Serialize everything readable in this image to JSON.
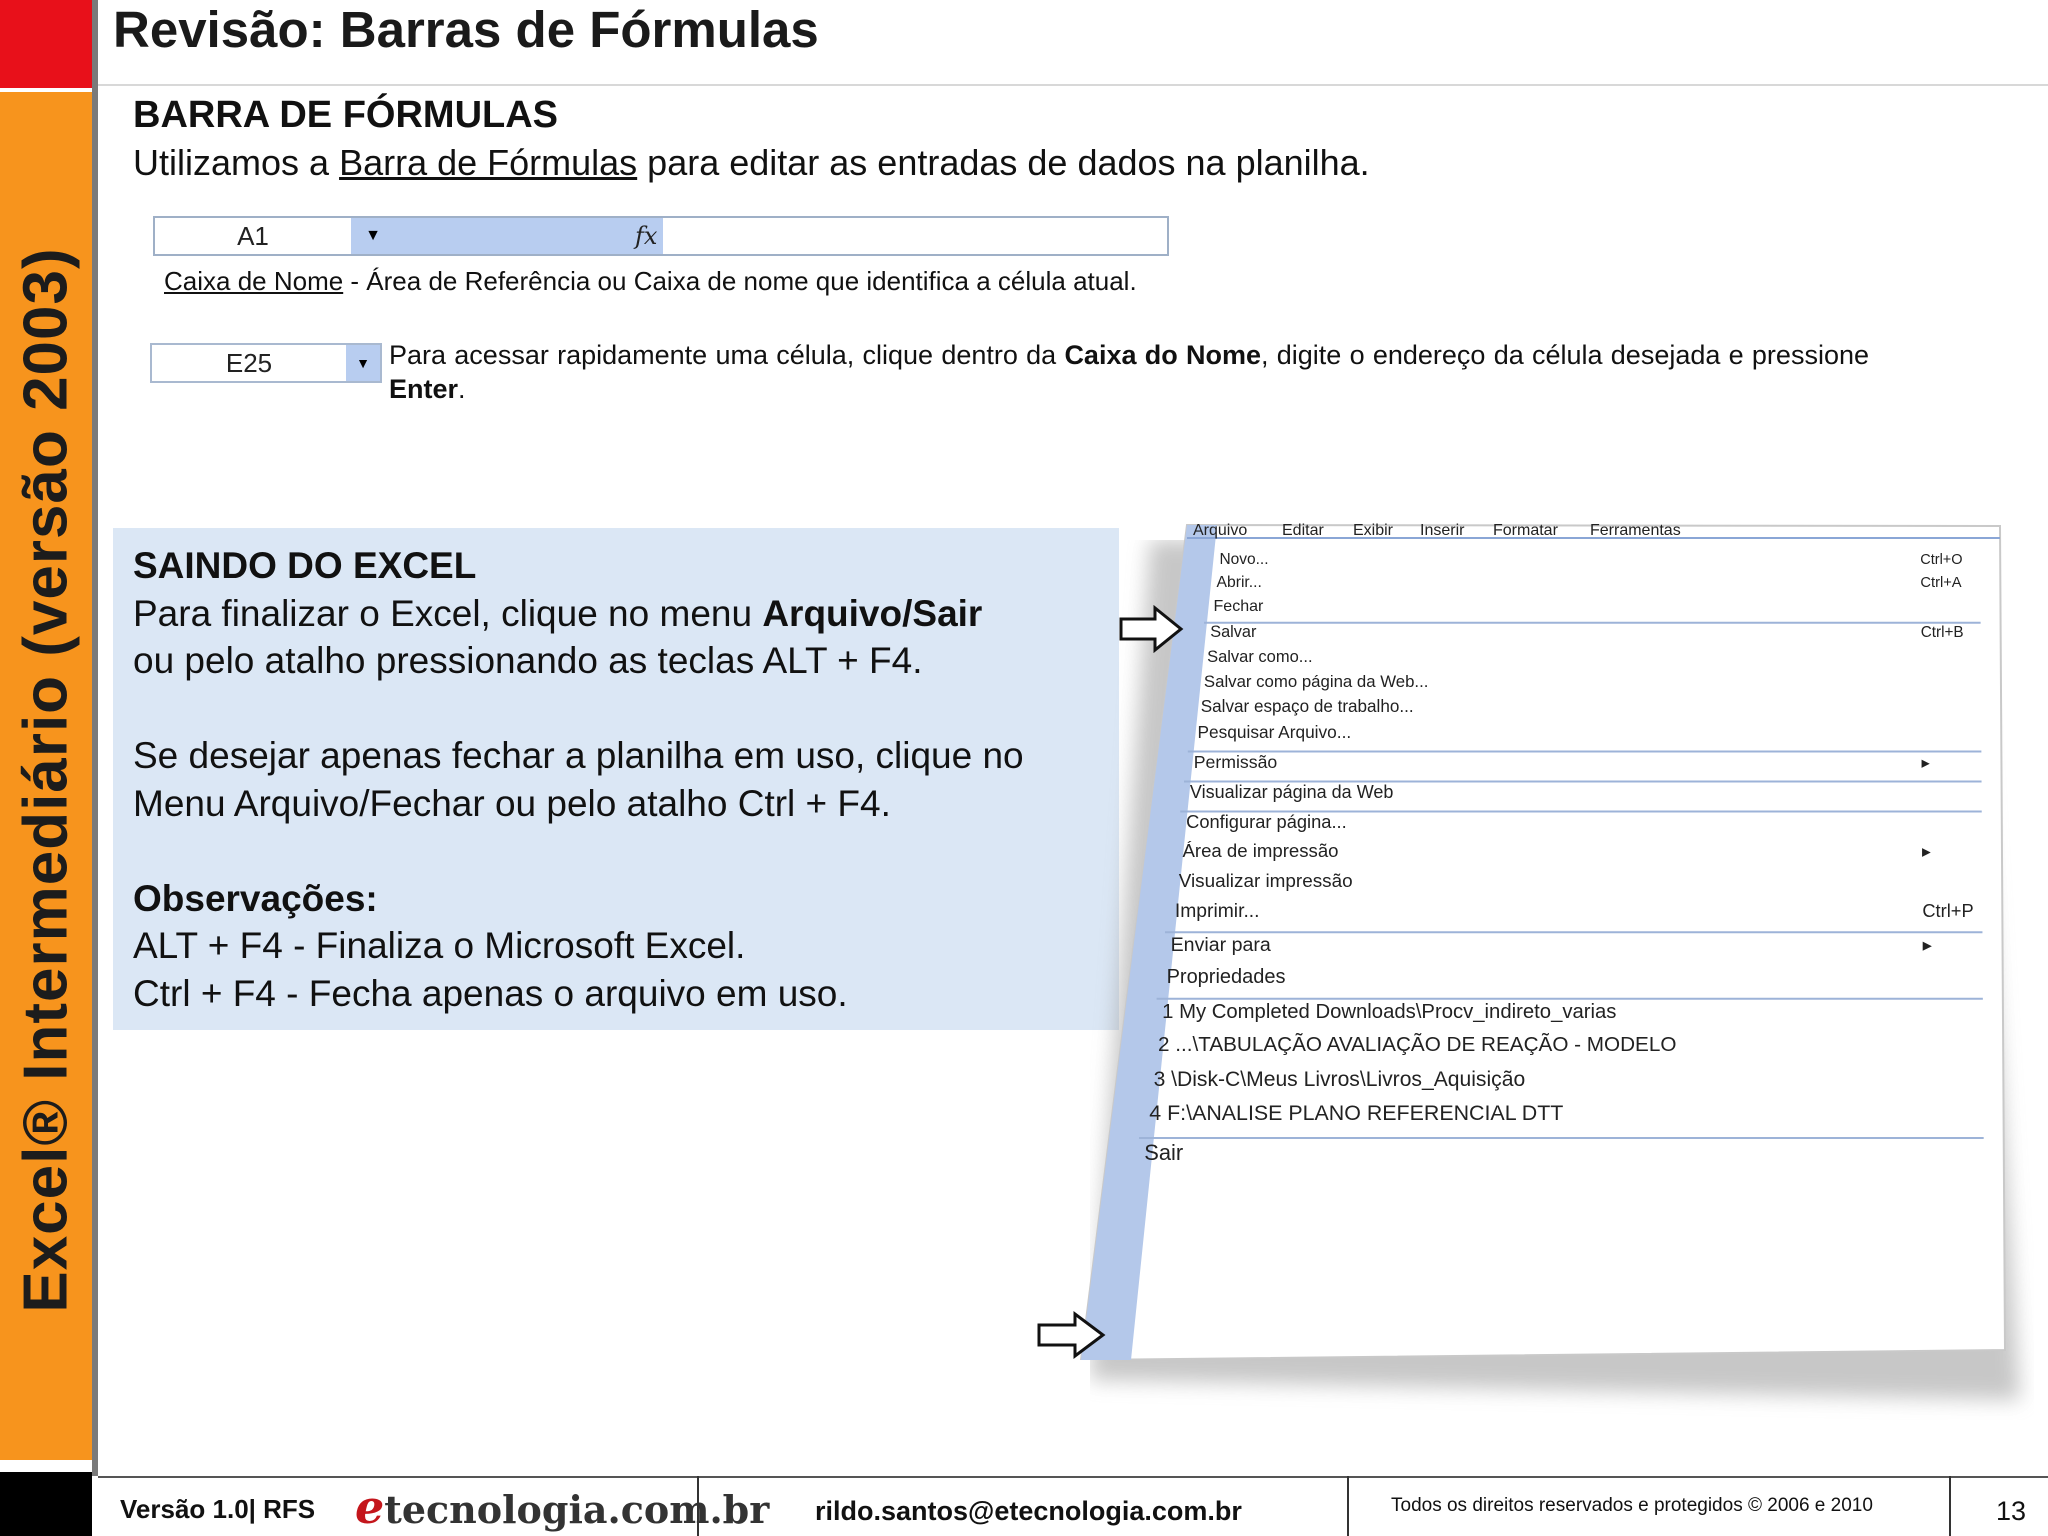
{
  "sidebar": {
    "vertical_title": "Excel® Intermediário (versão 2003)"
  },
  "header": {
    "title": "Revisão: Barras de Fórmulas"
  },
  "section_formula_bar": {
    "heading": "BARRA DE FÓRMULAS",
    "intro_pre": "Utilizamos a ",
    "intro_link": "Barra de Fórmulas",
    "intro_post": " para editar as entradas de dados na planilha.",
    "formula_bar": {
      "name_box": "A1",
      "fx_label": "fx"
    },
    "caption_link": "Caixa de Nome",
    "caption_rest": " - Área de Referência ou Caixa de nome que identifica a célula atual.",
    "name_box_example": "E25",
    "tip_1": "Para acessar rapidamente uma célula, clique dentro da ",
    "tip_bold_1": "Caixa do Nome",
    "tip_2": ", digite o endereço da célula desejada e pressione ",
    "tip_bold_2": "Enter",
    "tip_3": "."
  },
  "section_exit": {
    "heading": "SAINDO DO EXCEL",
    "p1_pre": "Para finalizar o Excel, clique no menu ",
    "p1_bold": "Arquivo/Sair",
    "p1_post": "ou pelo atalho pressionando as teclas ALT + F4.",
    "p2_line1": "Se desejar apenas fechar a planilha em uso, clique no",
    "p2_line2": "Menu Arquivo/Fechar ou pelo atalho Ctrl + F4.",
    "obs_heading": "Observações:",
    "obs_line1": "ALT + F4  -  Finaliza o Microsoft Excel.",
    "obs_line2": "Ctrl + F4  -  Fecha apenas o arquivo em uso."
  },
  "excel_menu": {
    "menubar": [
      "Arquivo",
      "Editar",
      "Exibir",
      "Inserir",
      "Formatar",
      "Ferramentas"
    ],
    "items": [
      {
        "label": "Novo...",
        "shortcut": "Ctrl+O"
      },
      {
        "label": "Abrir...",
        "shortcut": "Ctrl+A"
      },
      {
        "label": "Fechar",
        "shortcut": ""
      },
      {
        "label": "Salvar",
        "shortcut": "Ctrl+B"
      },
      {
        "label": "Salvar como...",
        "shortcut": ""
      },
      {
        "label": "Salvar como página da Web...",
        "shortcut": ""
      },
      {
        "label": "Salvar espaço de trabalho...",
        "shortcut": ""
      },
      {
        "label": "Pesquisar Arquivo...",
        "shortcut": ""
      },
      {
        "label": "Permissão",
        "shortcut": "▸"
      },
      {
        "label": "Visualizar página da Web",
        "shortcut": ""
      },
      {
        "label": "Configurar página...",
        "shortcut": ""
      },
      {
        "label": "Área de impressão",
        "shortcut": "▸"
      },
      {
        "label": "Visualizar impressão",
        "shortcut": ""
      },
      {
        "label": "Imprimir...",
        "shortcut": "Ctrl+P"
      },
      {
        "label": "Enviar para",
        "shortcut": "▸"
      },
      {
        "label": "Propriedades",
        "shortcut": ""
      },
      {
        "label": "1 My Completed Downloads\\Procv_indireto_varias",
        "shortcut": ""
      },
      {
        "label": "2 ...\\TABULAÇÃO AVALIAÇÃO DE REAÇÃO - MODELO",
        "shortcut": ""
      },
      {
        "label": "3 \\Disk-C\\Meus Livros\\Livros_Aquisição",
        "shortcut": ""
      },
      {
        "label": "4 F:\\ANALISE PLANO REFERENCIAL DTT",
        "shortcut": ""
      },
      {
        "label": "Sair",
        "shortcut": ""
      }
    ]
  },
  "footer": {
    "version": "Versão 1.0| RFS",
    "logo_e": "e",
    "logo_rest": "tecnologia.com.br",
    "email": "rildo.santos@etecnologia.com.br",
    "rights": "Todos os direitos reservados e protegidos © 2006 e 2010",
    "page_number": "13"
  },
  "colors": {
    "red": "#e8101a",
    "orange": "#f7941d",
    "box_blue": "#dbe7f5",
    "menu_blue": "#b8cdf0"
  }
}
